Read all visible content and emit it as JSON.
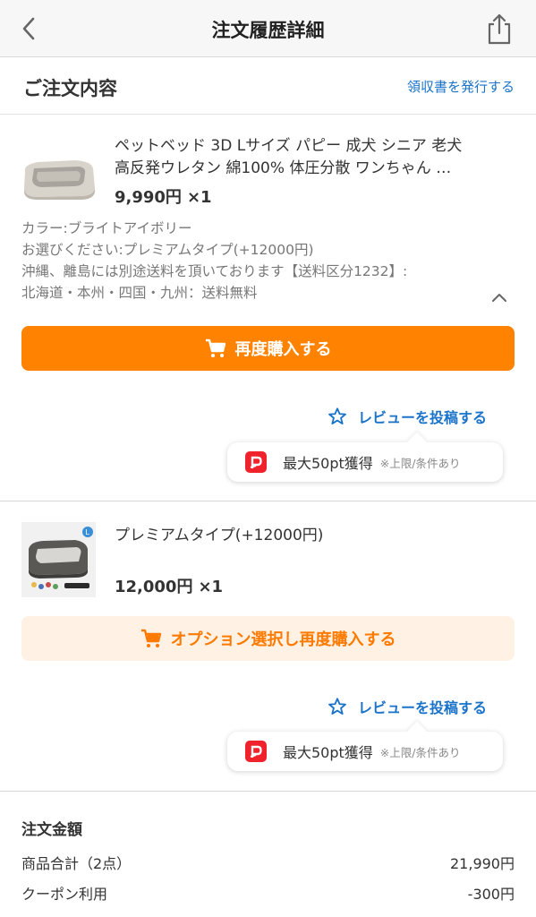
{
  "header": {
    "title": "注文履歴詳細",
    "back_icon": "chevron-left-icon",
    "share_icon": "share-icon"
  },
  "order": {
    "section_title": "ご注文内容",
    "receipt_link": "領収書を発行する"
  },
  "items": [
    {
      "title_line1": "ペットベッド 3D Lサイズ パピー 成犬 シニア 老犬",
      "title_line2": "高反発ウレタン 綿100% 体圧分散 ワンちゃん …",
      "price": "9,990円",
      "qty": "×1",
      "options": [
        "カラー:ブライトアイボリー",
        "お選びください:プレミアムタイプ(+12000円)",
        "沖縄、離島には別途送料を頂いております【送料区分1232】:",
        "北海道・本州・四国・九州：送料無料"
      ],
      "rebuy_label": "再度購入する",
      "review_label": "レビューを投稿する",
      "points_main": "最大50pt獲得",
      "points_note": "※上限/条件あり"
    },
    {
      "title": "プレミアムタイプ(+12000円)",
      "price": "12,000円",
      "qty": "×1",
      "rebuy_label": "オプション選択し再度購入する",
      "review_label": "レビューを投稿する",
      "points_main": "最大50pt獲得",
      "points_note": "※上限/条件あり"
    }
  ],
  "summary": {
    "title": "注文金額",
    "rows": [
      {
        "label": "商品合計（2点）",
        "value": "21,990円"
      },
      {
        "label": "クーポン利用",
        "value": "-300円"
      }
    ]
  },
  "colors": {
    "accent": "#ff8200",
    "accent_light": "#fff2e4",
    "link": "#1a73c9",
    "points_red": "#f0232d"
  }
}
